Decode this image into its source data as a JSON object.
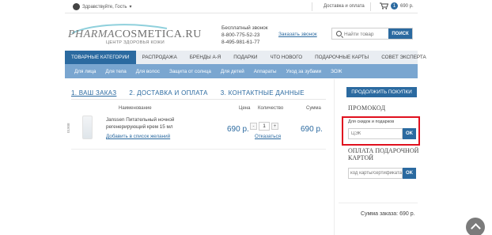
{
  "topbar": {
    "user_label": "Здравствуйте, Гость",
    "delivery_label": "Доставка и оплата",
    "cart_count": "1",
    "cart_total": "690 р."
  },
  "header": {
    "logo_pharma": "PHARMA",
    "logo_cosmetica": "COSMETICA.RU",
    "logo_tagline": "ЦЕНТР ЗДОРОВЬЯ КОЖИ",
    "free_call_label": "Бесплатный звонок",
    "phone1": "8-800-775-52-23",
    "phone2": "8-495-981-61-77",
    "callback_label": "Заказать звонок",
    "search_placeholder": "Найти товар",
    "search_button": "ПОИСК"
  },
  "nav_primary": [
    {
      "label": "ТОВАРНЫЕ КАТЕГОРИИ",
      "active": true
    },
    {
      "label": "РАСПРОДАЖА",
      "active": false
    },
    {
      "label": "БРЕНДЫ А-Я",
      "active": false
    },
    {
      "label": "ПОДАРКИ",
      "active": false
    },
    {
      "label": "ЧТО НОВОГО",
      "active": false
    },
    {
      "label": "ПОДАРОЧНЫЕ КАРТЫ",
      "active": false
    },
    {
      "label": "СОВЕТ ЭКСПЕРТА",
      "active": false
    }
  ],
  "nav_secondary": [
    {
      "label": "Для лица"
    },
    {
      "label": "Для тела"
    },
    {
      "label": "Для волос"
    },
    {
      "label": "Защита от солнца"
    },
    {
      "label": "Для детей"
    },
    {
      "label": "Аппараты"
    },
    {
      "label": "Уход за зубами"
    },
    {
      "label": "ЗОЖ"
    }
  ],
  "checkout_steps": [
    {
      "label": "1. ВАШ ЗАКАЗ",
      "active": true
    },
    {
      "label": "2. ДОСТАВКА И ОПЛАТА",
      "active": false
    },
    {
      "label": "3. КОНТАКТНЫЕ ДАННЫЕ",
      "active": false
    }
  ],
  "cart_table": {
    "headers": {
      "name": "Наименование",
      "price": "Цена",
      "quantity": "Количество",
      "sum": "Сумма"
    },
    "item": {
      "code": "01908",
      "name": "Janssen Питательный ночной регенерирующий крем 15 мл",
      "wishlist_link": "Добавить в список желаний",
      "price": "690 р.",
      "quantity": "1",
      "minus": "-",
      "plus": "+",
      "remove_link": "Отказаться",
      "sum": "690 р."
    }
  },
  "sidebar": {
    "continue_button": "ПРОДОЛЖИТЬ ПОКУПКИ",
    "promo_title": "ПРОМОКОД",
    "promo_hint": "Для скидок и подарков",
    "promo_placeholder": "ЦЭК",
    "promo_ok": "OK",
    "gift_title": "ОПЛАТА ПОДАРОЧНОЙ КАРТОЙ",
    "gift_placeholder": "код карты/сертификата",
    "gift_ok": "OK",
    "order_sum": "Сумма заказа: 690 р."
  },
  "colors": {
    "accent": "#2b6aa0",
    "nav_secondary_bg": "#7aa6d0",
    "highlight": "#e0101e"
  }
}
